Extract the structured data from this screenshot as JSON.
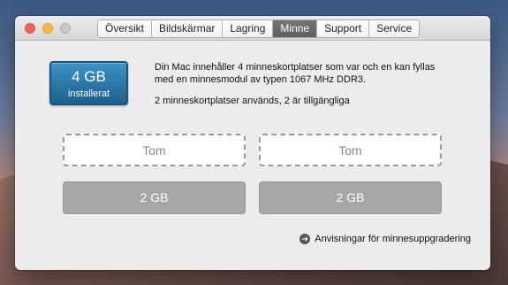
{
  "window": {
    "tabs": [
      {
        "label": "Översikt",
        "active": false
      },
      {
        "label": "Bildskärmar",
        "active": false
      },
      {
        "label": "Lagring",
        "active": false
      },
      {
        "label": "Minne",
        "active": true
      },
      {
        "label": "Support",
        "active": false
      },
      {
        "label": "Service",
        "active": false
      }
    ]
  },
  "memory": {
    "size": "4 GB",
    "status": "installerat",
    "description": "Din Mac innehåller 4 minneskortplatser som var och en kan fyllas med en minnesmodul av typen 1067 MHz DDR3.",
    "slots_info": "2 minneskortplatser används, 2 är tillgängliga",
    "slots": [
      {
        "label": "Tom",
        "state": "empty"
      },
      {
        "label": "Tom",
        "state": "empty"
      },
      {
        "label": "2 GB",
        "state": "installed"
      },
      {
        "label": "2 GB",
        "state": "installed"
      }
    ],
    "upgrade_link": "Anvisningar för minnesuppgradering",
    "accent_color": "#2a79ae"
  },
  "icons": {
    "upgrade_link_icon": "arrow-circle-icon"
  }
}
